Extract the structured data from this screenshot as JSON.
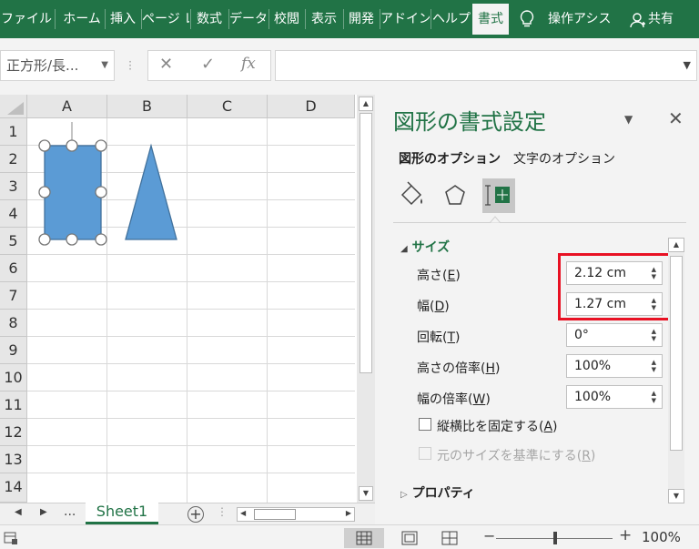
{
  "ribbon": {
    "tabs": [
      "ファイル",
      "ホーム",
      "挿入",
      "ページ レ",
      "数式",
      "データ",
      "校閲",
      "表示",
      "開発",
      "アドイン",
      "ヘルプ",
      "書式"
    ],
    "tell_me": "操作アシス",
    "share": "共有",
    "accent": "#217346"
  },
  "formula_bar": {
    "name_box": "正方形/長...",
    "fx": "fx",
    "formula": ""
  },
  "sheet": {
    "columns": [
      "A",
      "B",
      "C",
      "D"
    ],
    "rows": [
      "1",
      "2",
      "3",
      "4",
      "5",
      "6",
      "7",
      "8",
      "9",
      "10",
      "11",
      "12",
      "13",
      "14"
    ],
    "tab": "Sheet1",
    "ellipsis": "...",
    "shape_fill": "#5b9bd5",
    "shape_stroke": "#41719c"
  },
  "status": {
    "zoom": "100%"
  },
  "pane": {
    "title": "図形の書式設定",
    "tabs": [
      "図形のオプション",
      "文字のオプション"
    ],
    "section_size": "サイズ",
    "section_props": "プロパティ",
    "fields": [
      {
        "label": "高さ(",
        "key": "E",
        "value": "2.12 cm"
      },
      {
        "label": "幅(",
        "key": "D",
        "value": "1.27 cm"
      },
      {
        "label": "回転(",
        "key": "T",
        "value": "0°"
      },
      {
        "label": "高さの倍率(",
        "key": "H",
        "value": "100%"
      },
      {
        "label": "幅の倍率(",
        "key": "W",
        "value": "100%"
      }
    ],
    "lock_aspect": {
      "label": "縦横比を固定する(",
      "key": "A"
    },
    "relative_orig": {
      "label": "元のサイズを基準にする(",
      "key": "R"
    },
    "highlight": "#e81123"
  }
}
